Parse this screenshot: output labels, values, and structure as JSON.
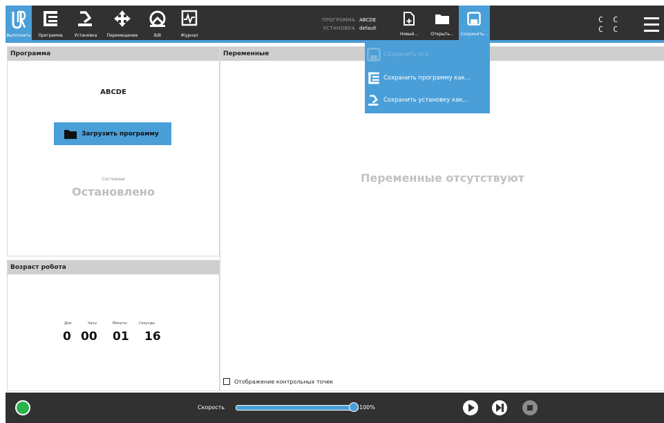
{
  "header": {
    "nav": [
      {
        "label": "Выполнить",
        "icon": "ur-logo-icon",
        "active": true
      },
      {
        "label": "Программа",
        "icon": "program-icon"
      },
      {
        "label": "Установка",
        "icon": "installation-icon"
      },
      {
        "label": "Перемещение",
        "icon": "move-icon"
      },
      {
        "label": "В/В",
        "icon": "io-icon"
      },
      {
        "label": "Журнал",
        "icon": "log-icon"
      }
    ],
    "program_key": "ПРОГРАММА",
    "program_value": "ABCDE",
    "installation_key": "УСТАНОВКА",
    "installation_value": "default",
    "file_new": "Новый...",
    "file_open": "Открыть...",
    "file_save": "Сохранить...",
    "cc_top": "C C",
    "cc_bottom": "C C"
  },
  "save_menu": {
    "save_all": "Сохранить все",
    "save_program_as": "Сохранить программу как...",
    "save_installation_as": "Сохранить установку как..."
  },
  "program_panel": {
    "header": "Программа",
    "name": "ABCDE",
    "load_button": "Загрузить программу",
    "state_label": "Состояние",
    "state_value": "Остановлено"
  },
  "robot_age": {
    "header": "Возраст робота",
    "labels": [
      "Дни",
      "Часы",
      "Минуты",
      "Секунды"
    ],
    "values": [
      "0",
      "00",
      "01",
      "16"
    ]
  },
  "variables": {
    "header": "Переменные",
    "empty_message": "Переменные отсутствуют",
    "checkpoint_label": "Отображение контрольных точек"
  },
  "footer": {
    "speed_label": "Скорость",
    "speed_value": "100%",
    "speed_fraction": 1.0
  },
  "colors": {
    "accent": "#4a9fd8",
    "bar": "#313131",
    "status_ok": "#2bb24c"
  }
}
